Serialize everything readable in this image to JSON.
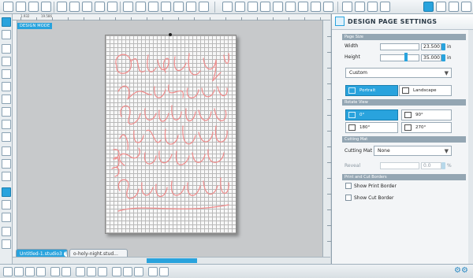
{
  "ruler_top_labels": [
    "1.932",
    "19.586"
  ],
  "design_mode_label": "DESIGN MODE",
  "document_tabs": [
    {
      "label": "Untitled-1.studio3",
      "badge": "5",
      "active": true
    },
    {
      "label": "o-holy-night.stud...",
      "badge": "",
      "active": false
    }
  ],
  "canvas_text_lines": [
    "O Holy Night",
    "the Stars are",
    "brightly Shining",
    "it is the Night",
    "of our dear",
    "Savior's Birth"
  ],
  "panel": {
    "title": "DESIGN PAGE SETTINGS",
    "page_size": {
      "header": "Page Size",
      "width_label": "Width",
      "width_value": "23.500",
      "height_label": "Height",
      "height_value": "35.000",
      "unit": "in",
      "preset": "Custom",
      "orientation_portrait": "Portrait",
      "orientation_landscape": "Landscape"
    },
    "rotate_view": {
      "header": "Rotate View",
      "options": [
        "0°",
        "90°",
        "180°",
        "270°"
      ],
      "selected": "0°"
    },
    "cutting_mat": {
      "header": "Cutting Mat",
      "label": "Cutting Mat",
      "value": "None",
      "reveal_label": "Reveal",
      "reveal_value": "0.0",
      "reveal_unit": "%"
    },
    "borders": {
      "header": "Print and Cut Borders",
      "show_print_border": "Show Print Border",
      "show_cut_border": "Show Cut Border"
    }
  },
  "colors": {
    "accent": "#29a3dd",
    "script": "#f08b8b"
  }
}
